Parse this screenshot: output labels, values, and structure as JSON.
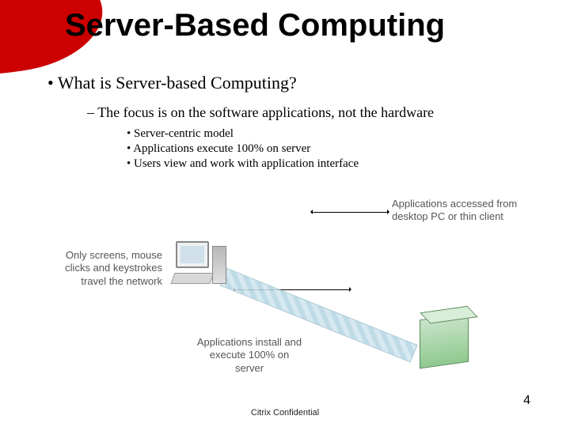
{
  "title": "Server-Based Computing",
  "bullets": {
    "l1": "What is Server-based Computing?",
    "l2": "The focus is on the software applications, not the hardware",
    "l3a": "Server-centric model",
    "l3b": "Applications execute 100% on server",
    "l3c": "Users view and work with application interface"
  },
  "captions": {
    "top": "Applications accessed from desktop PC or thin client",
    "left": "Only screens, mouse clicks and keystrokes travel the network",
    "bottom": "Applications install and execute 100% on server"
  },
  "footer": "Citrix Confidential",
  "page": "4"
}
